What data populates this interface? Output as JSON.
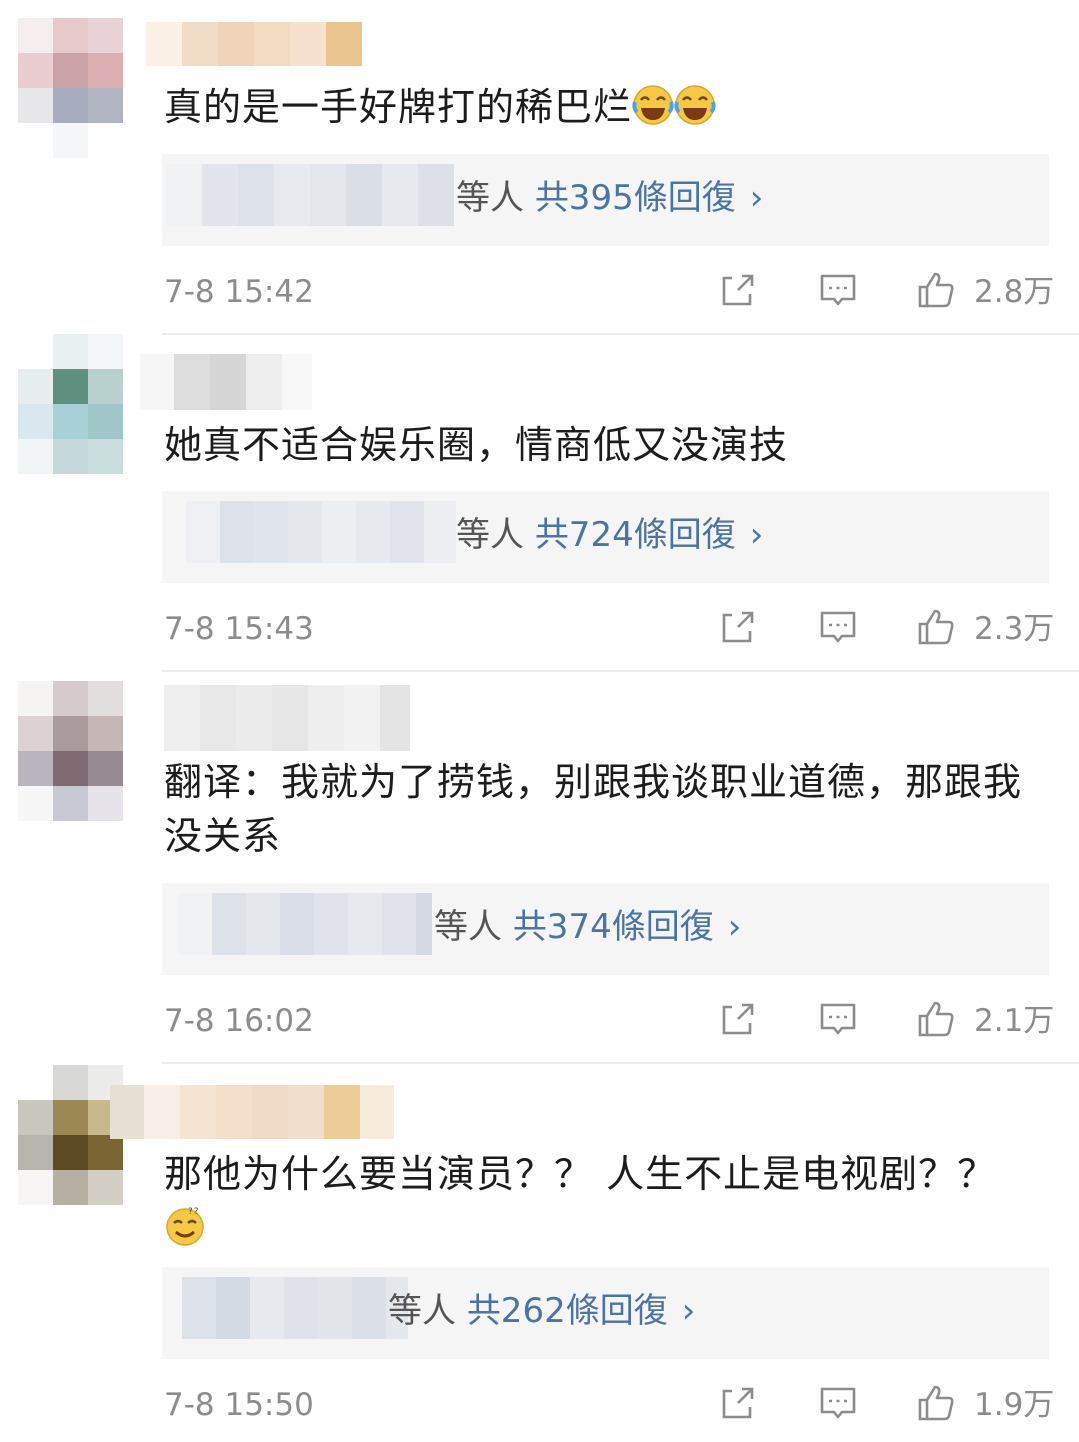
{
  "comments": [
    {
      "text": "真的是一手好牌打的稀巴烂",
      "emoji_names": [
        "laughing-crying-emoji",
        "laughing-crying-emoji"
      ],
      "reply_who": "等人",
      "reply_count": "共395條回復",
      "time": "7-8 15:42",
      "likes": "2.8万"
    },
    {
      "text": "她真不适合娱乐圈，情商低又没演技",
      "emoji_names": [],
      "reply_who": "等人",
      "reply_count": "共724條回復",
      "time": "7-8 15:43",
      "likes": "2.3万"
    },
    {
      "text": "翻译：我就为了捞钱，别跟我谈职业道德，那跟我没关系",
      "emoji_names": [],
      "reply_who": "等人",
      "reply_count": "共374條回復",
      "time": "7-8 16:02",
      "likes": "2.1万"
    },
    {
      "text": "那他为什么要当演员？？ 人生不止是电视剧？？",
      "emoji_names": [
        "dizzy-smile-emoji"
      ],
      "reply_who": "等人",
      "reply_count": "共262條回復",
      "time": "7-8 15:50",
      "likes": "1.9万"
    }
  ],
  "reply_chevron": "›",
  "icons": {
    "share": "share-icon",
    "comment": "comment-icon",
    "like": "thumbs-up-icon"
  },
  "colors": {
    "link": "#4a74a6",
    "meta": "#8c8c8c",
    "reply_bg": "#f5f5f5"
  }
}
